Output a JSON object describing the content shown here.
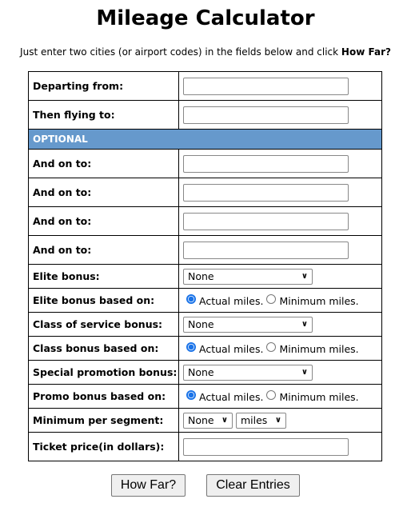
{
  "title": "Mileage Calculator",
  "intro": {
    "text": "Just enter two cities (or airport codes) in the fields below and click ",
    "bold": "How Far?"
  },
  "form": {
    "departing_label": "Departing from:",
    "then_label": "Then flying to:",
    "optional_label": "OPTIONAL",
    "and_on_label": "And on to:",
    "elite_bonus_label": "Elite bonus:",
    "elite_based_label": "Elite bonus based on:",
    "class_bonus_label": "Class of service bonus:",
    "class_based_label": "Class bonus based on:",
    "promo_bonus_label": "Special promotion bonus:",
    "promo_based_label": "Promo bonus based on:",
    "min_segment_label": "Minimum per segment:",
    "ticket_label": "Ticket price(in dollars):",
    "select_none": "None",
    "select_miles": "miles",
    "actual": "Actual miles.",
    "minimum": "Minimum miles.",
    "selected_basis": "actual"
  },
  "buttons": {
    "how_far": "How Far?",
    "clear": "Clear Entries"
  }
}
